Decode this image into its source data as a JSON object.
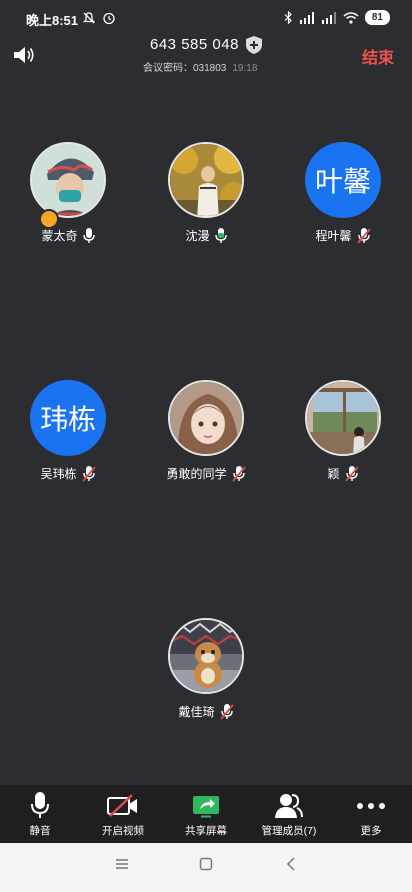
{
  "status": {
    "time": "晚上8:51",
    "battery": "81"
  },
  "header": {
    "meeting_id": "643 585 048",
    "password_label": "会议密码：031803",
    "elapsed": "19:18",
    "end_label": "结束"
  },
  "participants": [
    {
      "name": "蒙太奇",
      "avatar_type": "photo",
      "mic": "on-white",
      "host": true
    },
    {
      "name": "沈漫",
      "avatar_type": "photo",
      "mic": "on-green"
    },
    {
      "name": "程叶馨",
      "avatar_type": "text",
      "avatar_text": "叶馨",
      "mic": "muted"
    },
    {
      "name": "吴玮栋",
      "avatar_type": "text",
      "avatar_text": "玮栋",
      "mic": "muted"
    },
    {
      "name": "勇敢的同学",
      "avatar_type": "photo",
      "mic": "muted"
    },
    {
      "name": "颖",
      "avatar_type": "photo",
      "mic": "muted"
    },
    {
      "name": "戴佳琦",
      "avatar_type": "photo",
      "mic": "muted"
    }
  ],
  "toolbar": {
    "mute": "静音",
    "video": "开启视频",
    "share": "共享屏幕",
    "members": "管理成员(7)",
    "more": "更多"
  },
  "colors": {
    "accent_blue": "#1a73f0",
    "end_red": "#f0524f",
    "mute_red": "#e04a4a",
    "share_green": "#2fb85d"
  }
}
